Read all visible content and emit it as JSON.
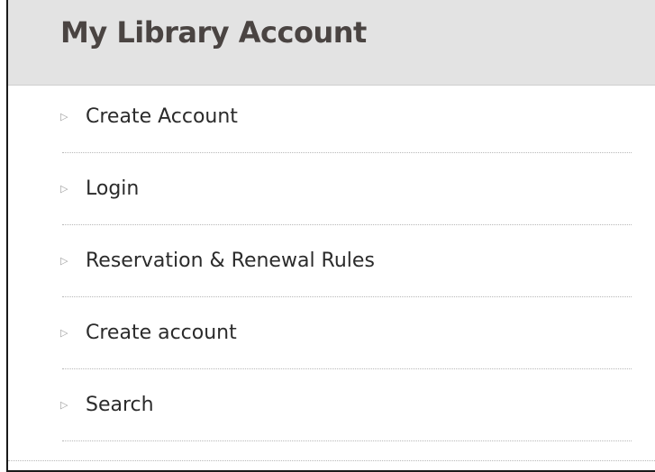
{
  "header": {
    "title": "My Library Account"
  },
  "menu": {
    "bullet_icon": "triangle-right-icon",
    "items": [
      {
        "label": "Create Account"
      },
      {
        "label": "Login"
      },
      {
        "label": "Reservation & Renewal Rules"
      },
      {
        "label": "Create account"
      },
      {
        "label": "Search"
      }
    ]
  },
  "colors": {
    "header_background": "#e3e3e3",
    "title_text": "#4a4442",
    "link_text": "#2b2b2b",
    "bullet": "#a0a0a0",
    "border": "#1a1a1a"
  }
}
